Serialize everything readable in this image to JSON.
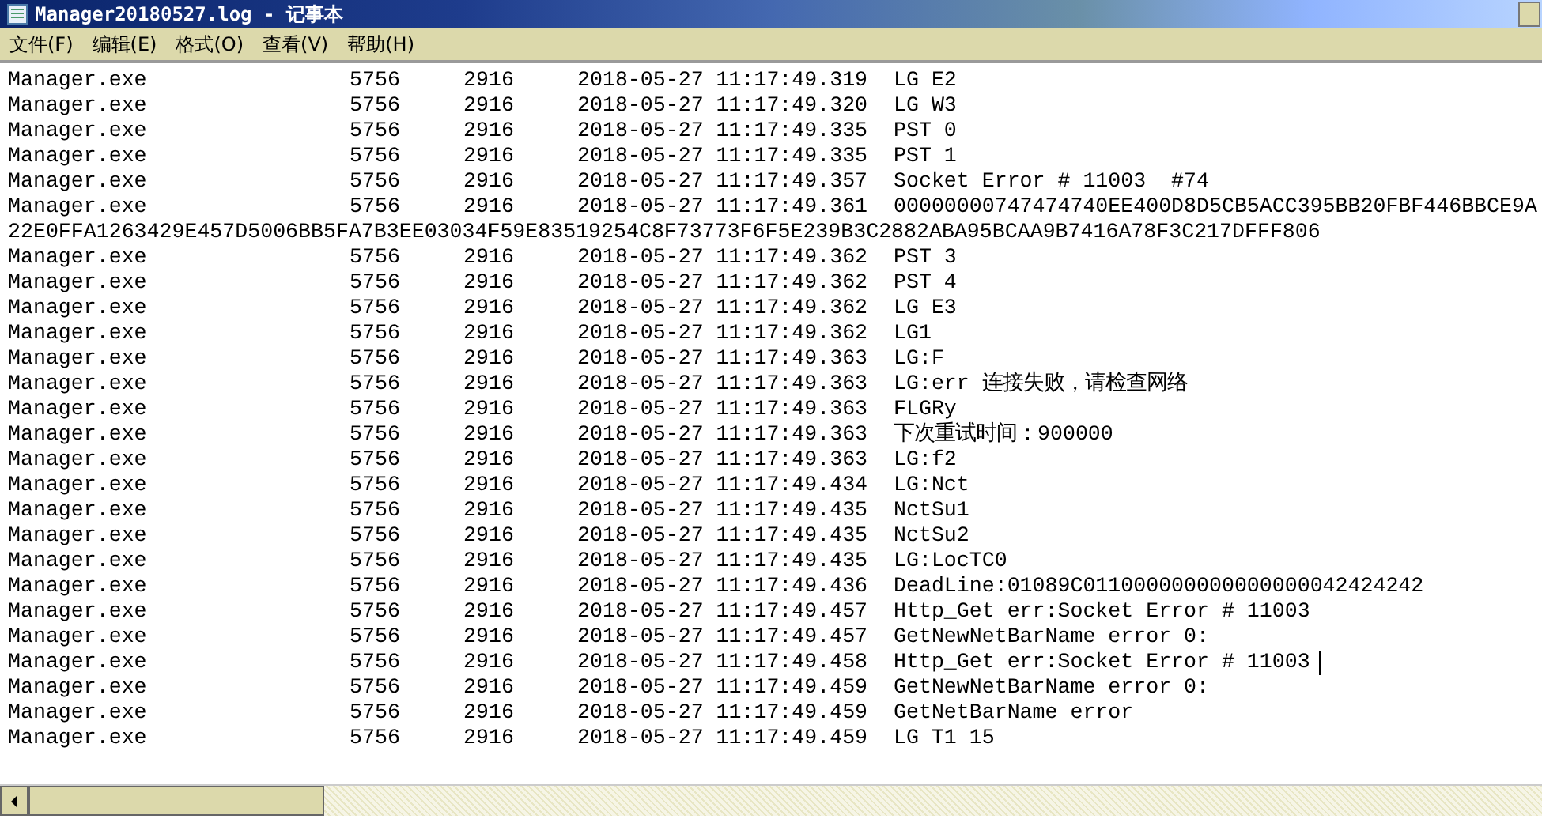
{
  "window": {
    "title": "Manager20180527.log - 记事本"
  },
  "menu": [
    "文件(F)",
    "编辑(E)",
    "格式(O)",
    "查看(V)",
    "帮助(H)"
  ],
  "lines": [
    {
      "kind": "entry",
      "process": "Manager.exe",
      "pid": "5756",
      "tid": "2916",
      "time": "2018-05-27 11:17:49.319",
      "message": "LG E2",
      "caret": false
    },
    {
      "kind": "entry",
      "process": "Manager.exe",
      "pid": "5756",
      "tid": "2916",
      "time": "2018-05-27 11:17:49.320",
      "message": "LG W3",
      "caret": false
    },
    {
      "kind": "entry",
      "process": "Manager.exe",
      "pid": "5756",
      "tid": "2916",
      "time": "2018-05-27 11:17:49.335",
      "message": "PST 0",
      "caret": false
    },
    {
      "kind": "entry",
      "process": "Manager.exe",
      "pid": "5756",
      "tid": "2916",
      "time": "2018-05-27 11:17:49.335",
      "message": "PST 1",
      "caret": false
    },
    {
      "kind": "entry",
      "process": "Manager.exe",
      "pid": "5756",
      "tid": "2916",
      "time": "2018-05-27 11:17:49.357",
      "message": "Socket Error # 11003  #74",
      "caret": false
    },
    {
      "kind": "entry",
      "process": "Manager.exe",
      "pid": "5756",
      "tid": "2916",
      "time": "2018-05-27 11:17:49.361",
      "message": "00000000747474740EE400D8D5CB5ACC395BB20FBF446BBCE9A",
      "caret": false
    },
    {
      "kind": "continuation",
      "message": "22E0FFA1263429E457D5006BB5FA7B3EE03034F59E83519254C8F73773F6F5E239B3C2882ABA95BCAA9B7416A78F3C217DFFF806",
      "caret": false
    },
    {
      "kind": "entry",
      "process": "Manager.exe",
      "pid": "5756",
      "tid": "2916",
      "time": "2018-05-27 11:17:49.362",
      "message": "PST 3",
      "caret": false
    },
    {
      "kind": "entry",
      "process": "Manager.exe",
      "pid": "5756",
      "tid": "2916",
      "time": "2018-05-27 11:17:49.362",
      "message": "PST 4",
      "caret": false
    },
    {
      "kind": "entry",
      "process": "Manager.exe",
      "pid": "5756",
      "tid": "2916",
      "time": "2018-05-27 11:17:49.362",
      "message": "LG E3",
      "caret": false
    },
    {
      "kind": "entry",
      "process": "Manager.exe",
      "pid": "5756",
      "tid": "2916",
      "time": "2018-05-27 11:17:49.362",
      "message": "LG1",
      "caret": false
    },
    {
      "kind": "entry",
      "process": "Manager.exe",
      "pid": "5756",
      "tid": "2916",
      "time": "2018-05-27 11:17:49.363",
      "message": "LG:F",
      "caret": false
    },
    {
      "kind": "entry",
      "process": "Manager.exe",
      "pid": "5756",
      "tid": "2916",
      "time": "2018-05-27 11:17:49.363",
      "message": "LG:err 连接失败，请检查网络",
      "caret": false
    },
    {
      "kind": "entry",
      "process": "Manager.exe",
      "pid": "5756",
      "tid": "2916",
      "time": "2018-05-27 11:17:49.363",
      "message": "FLGRy",
      "caret": false
    },
    {
      "kind": "entry",
      "process": "Manager.exe",
      "pid": "5756",
      "tid": "2916",
      "time": "2018-05-27 11:17:49.363",
      "message": "下次重试时间：900000",
      "caret": false
    },
    {
      "kind": "entry",
      "process": "Manager.exe",
      "pid": "5756",
      "tid": "2916",
      "time": "2018-05-27 11:17:49.363",
      "message": "LG:f2",
      "caret": false
    },
    {
      "kind": "entry",
      "process": "Manager.exe",
      "pid": "5756",
      "tid": "2916",
      "time": "2018-05-27 11:17:49.434",
      "message": "LG:Nct",
      "caret": false
    },
    {
      "kind": "entry",
      "process": "Manager.exe",
      "pid": "5756",
      "tid": "2916",
      "time": "2018-05-27 11:17:49.435",
      "message": "NctSu1",
      "caret": false
    },
    {
      "kind": "entry",
      "process": "Manager.exe",
      "pid": "5756",
      "tid": "2916",
      "time": "2018-05-27 11:17:49.435",
      "message": "NctSu2",
      "caret": false
    },
    {
      "kind": "entry",
      "process": "Manager.exe",
      "pid": "5756",
      "tid": "2916",
      "time": "2018-05-27 11:17:49.435",
      "message": "LG:LocTC0",
      "caret": false
    },
    {
      "kind": "entry",
      "process": "Manager.exe",
      "pid": "5756",
      "tid": "2916",
      "time": "2018-05-27 11:17:49.436",
      "message": "DeadLine:01089C011000000000000000042424242",
      "caret": false
    },
    {
      "kind": "entry",
      "process": "Manager.exe",
      "pid": "5756",
      "tid": "2916",
      "time": "2018-05-27 11:17:49.457",
      "message": "Http_Get err:Socket Error # 11003",
      "caret": false
    },
    {
      "kind": "entry",
      "process": "Manager.exe",
      "pid": "5756",
      "tid": "2916",
      "time": "2018-05-27 11:17:49.457",
      "message": "GetNewNetBarName error 0:",
      "caret": false
    },
    {
      "kind": "entry",
      "process": "Manager.exe",
      "pid": "5756",
      "tid": "2916",
      "time": "2018-05-27 11:17:49.458",
      "message": "Http_Get err:Socket Error # 11003",
      "caret": true
    },
    {
      "kind": "entry",
      "process": "Manager.exe",
      "pid": "5756",
      "tid": "2916",
      "time": "2018-05-27 11:17:49.459",
      "message": "GetNewNetBarName error 0:",
      "caret": false
    },
    {
      "kind": "entry",
      "process": "Manager.exe",
      "pid": "5756",
      "tid": "2916",
      "time": "2018-05-27 11:17:49.459",
      "message": "GetNetBarName error",
      "caret": false
    },
    {
      "kind": "entry",
      "process": "Manager.exe",
      "pid": "5756",
      "tid": "2916",
      "time": "2018-05-27 11:17:49.459",
      "message": "LG T1 15",
      "caret": false
    }
  ]
}
